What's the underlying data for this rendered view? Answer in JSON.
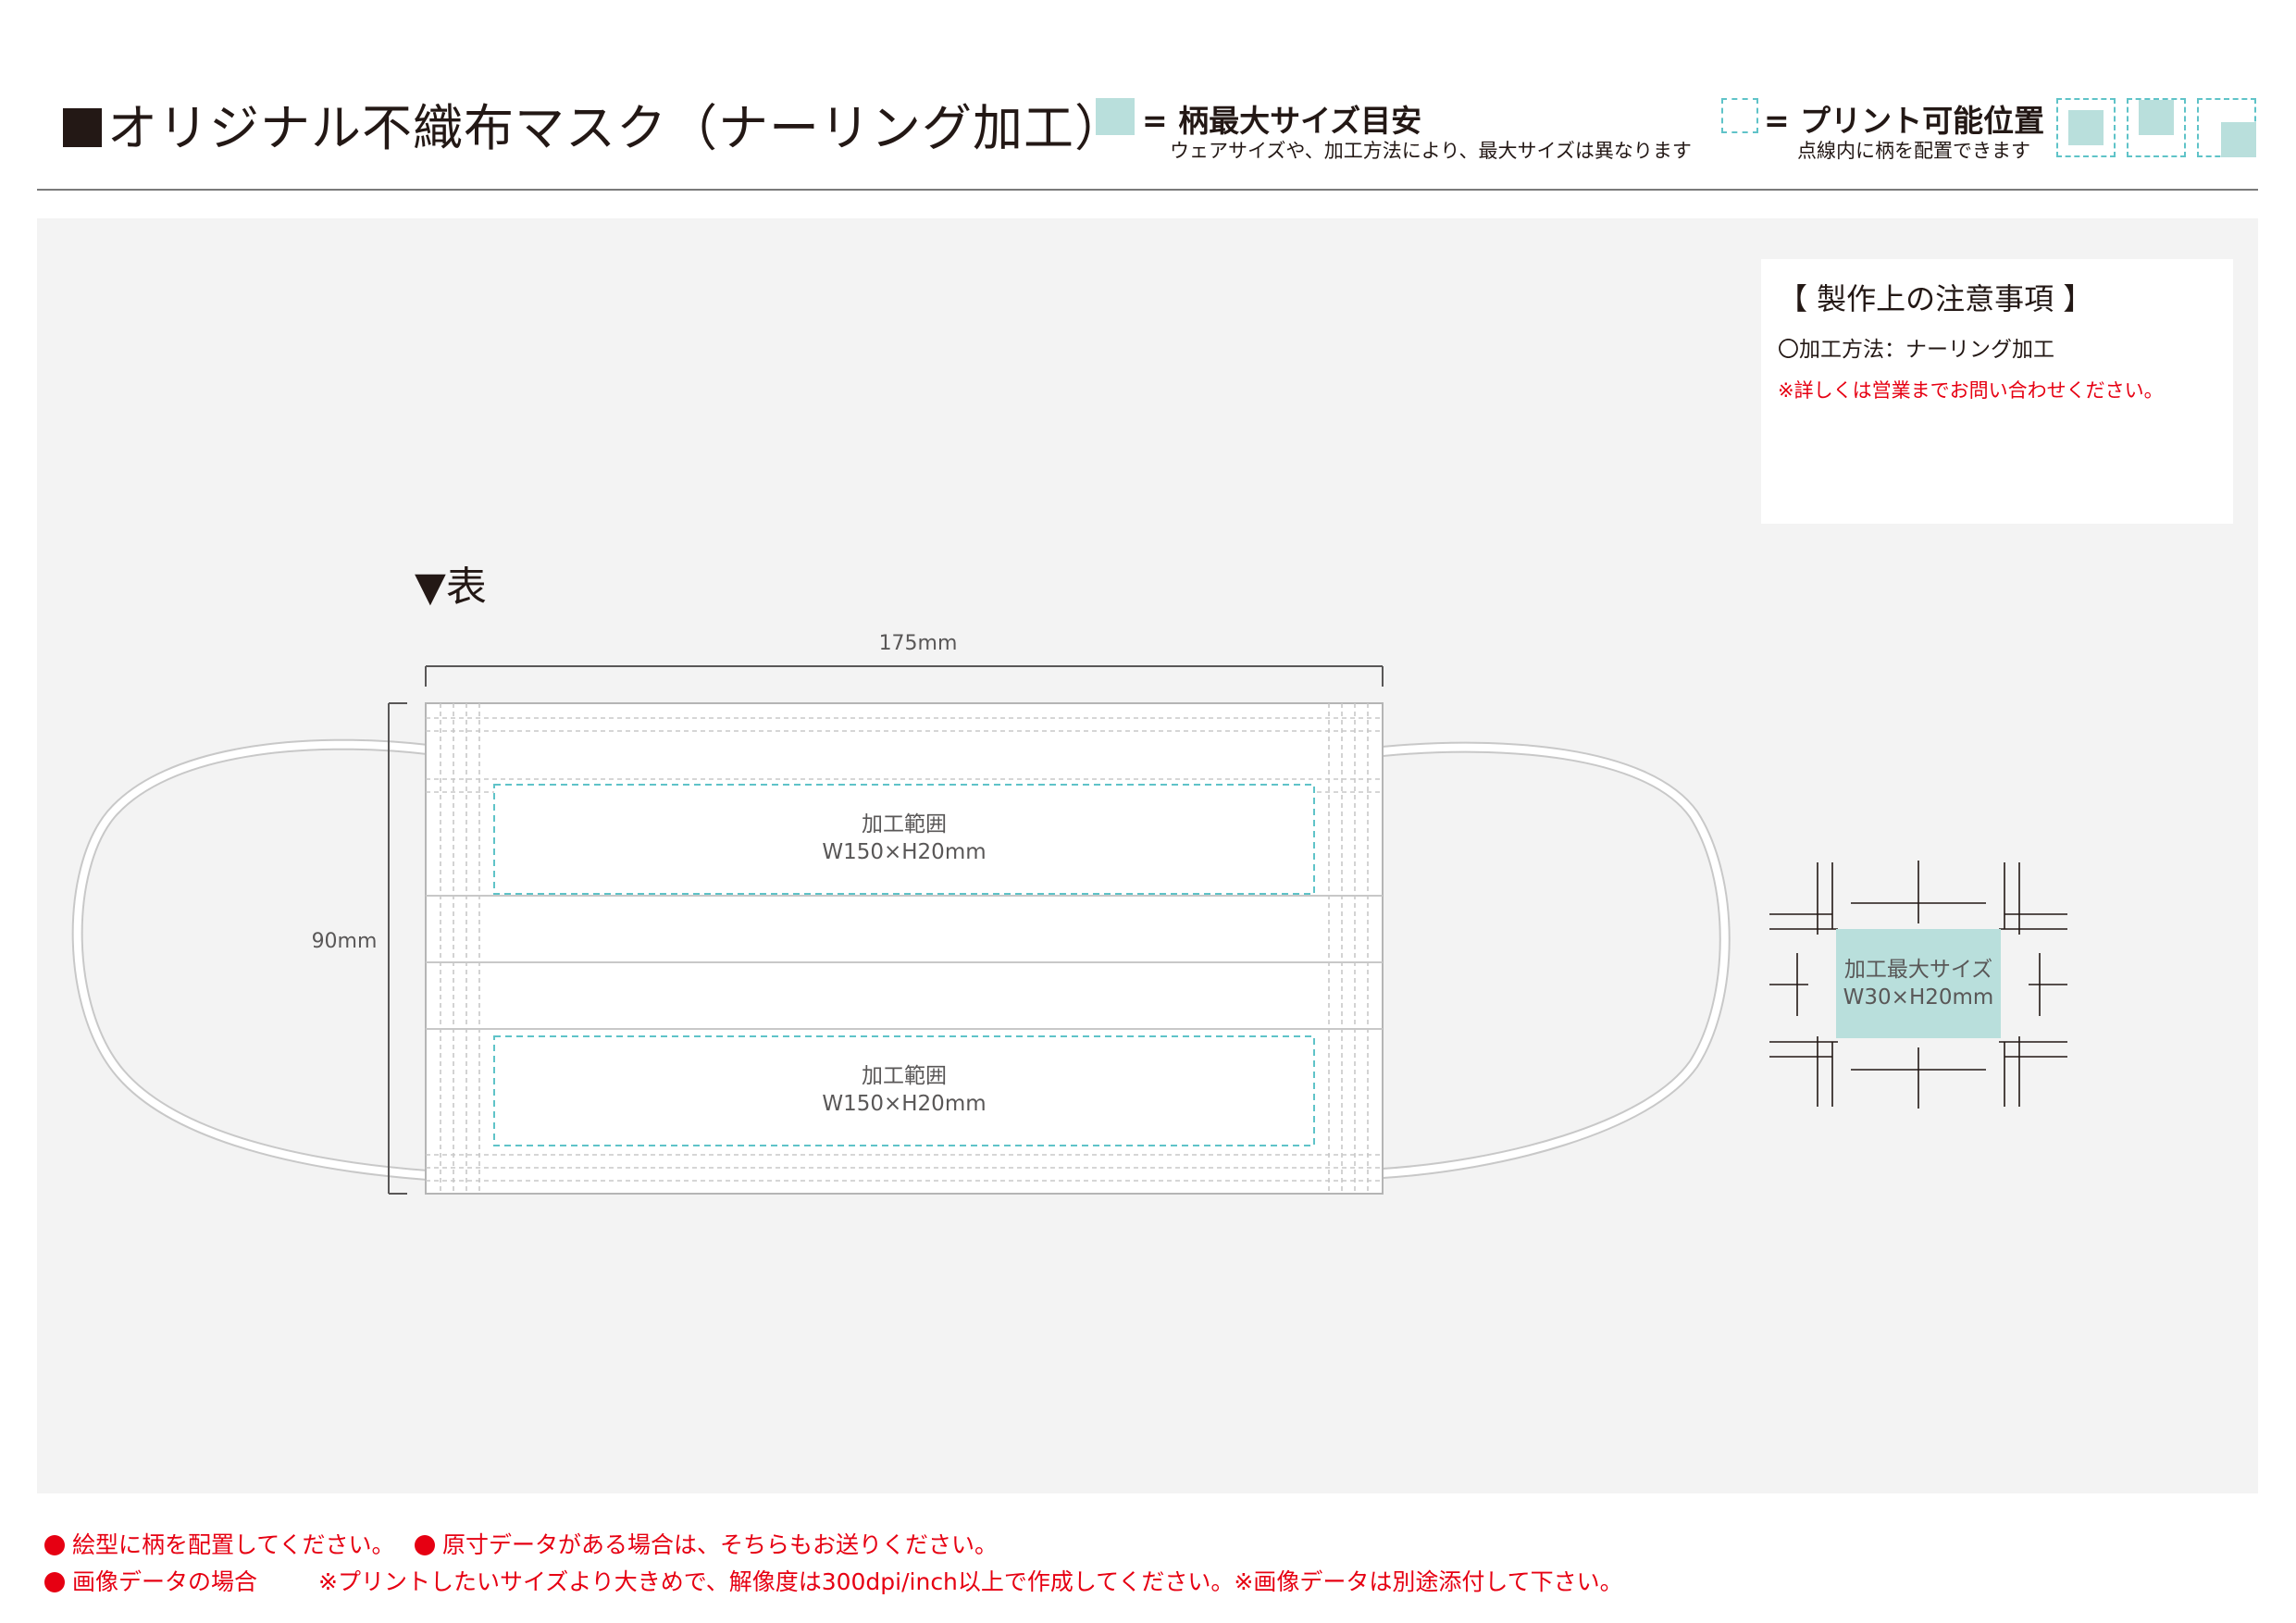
{
  "header": {
    "title": "オリジナル不織布マスク（ナーリング加工）",
    "legend_max_size": {
      "label": "= 柄最大サイズ目安",
      "note": "ウェアサイズや、加工方法により、最大サイズは異なります",
      "color": "#b9dfdc"
    },
    "legend_print_position": {
      "label": "= プリント可能位置",
      "note": "点線内に柄を配置できます",
      "color": "#5fc3c8"
    }
  },
  "notes": {
    "title": "【 製作上の注意事項 】",
    "method": "〇加工方法：ナーリング加工",
    "contact": "※詳しくは営業までお問い合わせください。"
  },
  "diagram": {
    "side_label": "▼表",
    "width_label": "175mm",
    "height_label": "90mm",
    "area_top": {
      "name": "加工範囲",
      "size": "W150×H20mm"
    },
    "area_bottom": {
      "name": "加工範囲",
      "size": "W150×H20mm"
    },
    "max_area": {
      "name": "加工最大サイズ",
      "size": "W30×H20mm"
    }
  },
  "footer": {
    "line1_a": "絵型に柄を配置してください。",
    "line1_b": "原寸データがある場合は、そちらもお送りください。",
    "line2_a": "画像データの場合",
    "line2_b": "※プリントしたいサイズより大きめで、解像度は300dpi/inch以上で作成してください。※画像データは別途添付して下さい。"
  }
}
